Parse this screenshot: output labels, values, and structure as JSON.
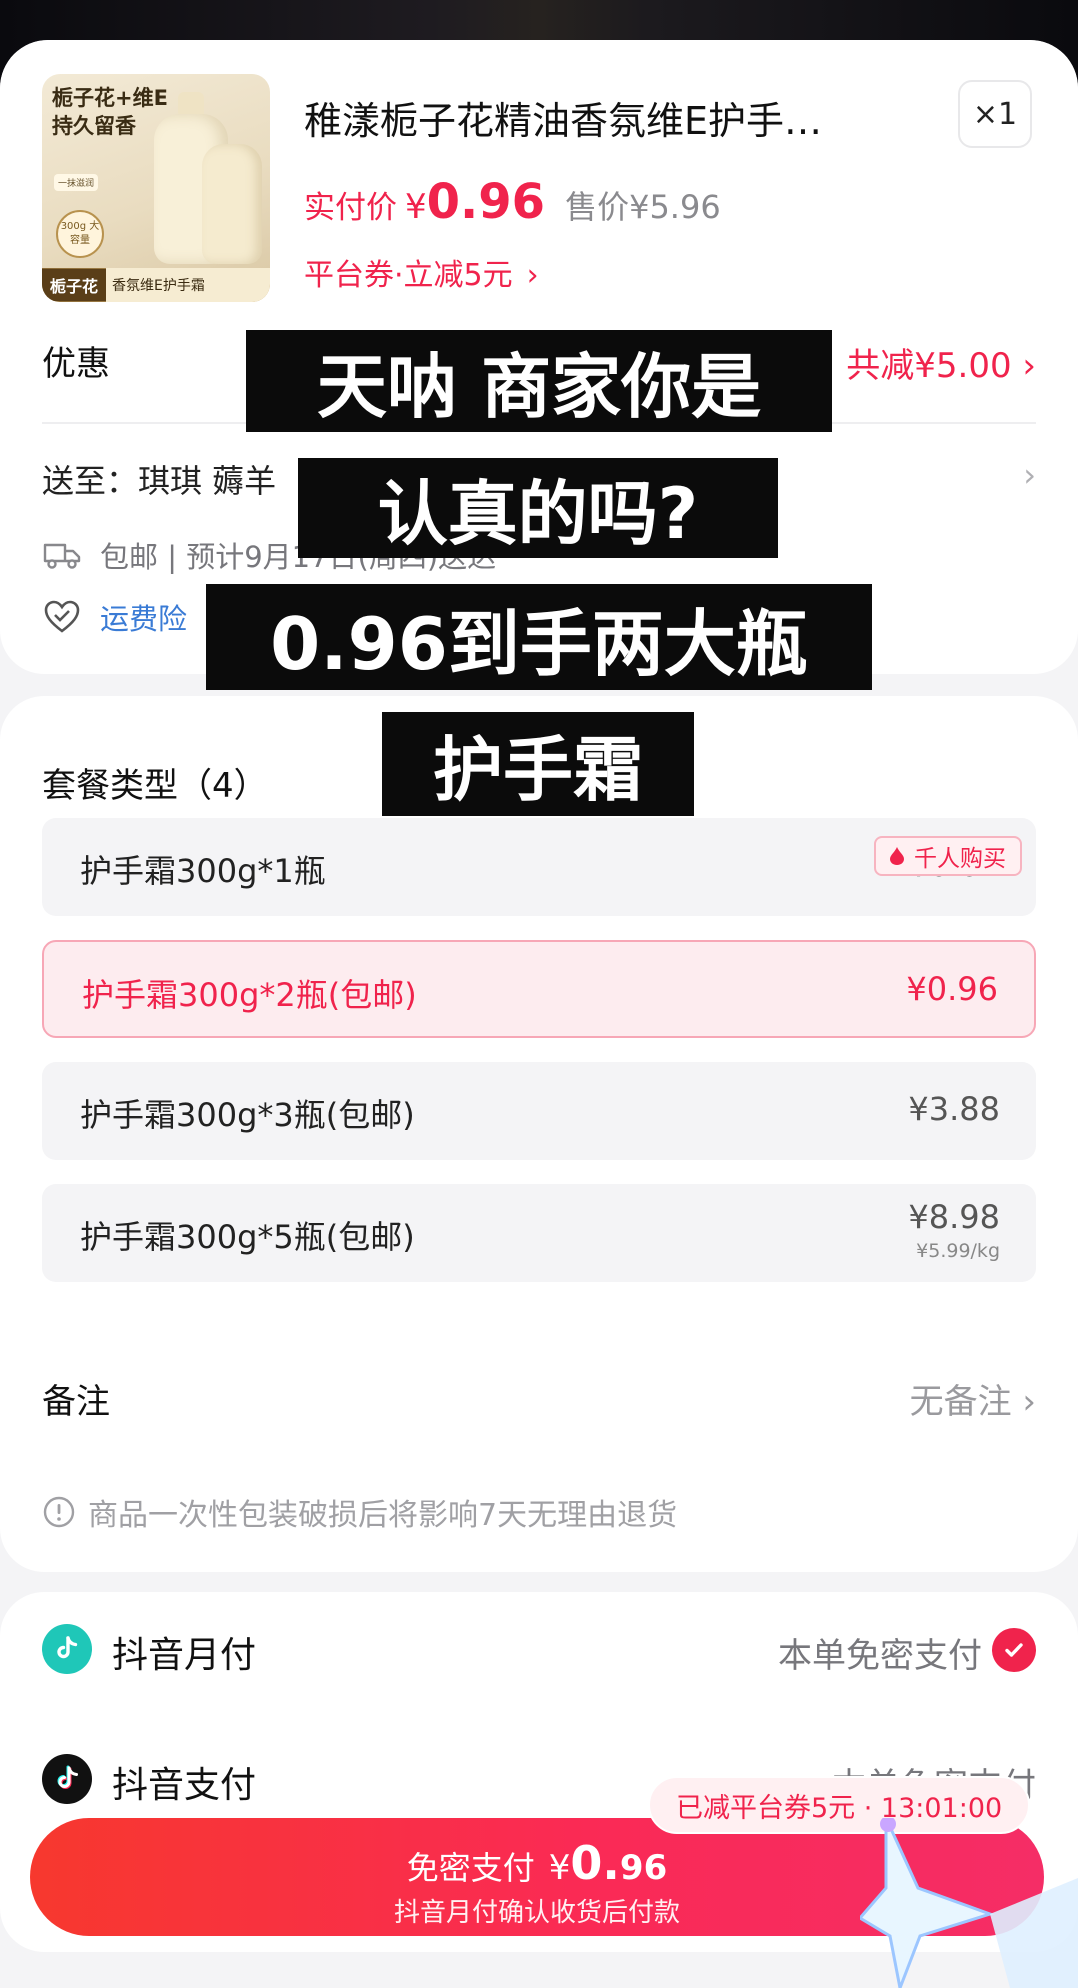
{
  "product": {
    "image_text_1": "栀子花+维E",
    "image_text_2": "持久留香",
    "image_text_3": "一抹滋润",
    "image_badge": "300g 大容量",
    "image_bar_1": "栀子花",
    "image_bar_2": "香氛维E护手霜",
    "title": "稚漾栀子花精油香氛维E护手…",
    "quantity": "×1",
    "actual_price_label": "实付价",
    "currency": "¥",
    "actual_price": "0.96",
    "original_price": "售价¥5.96",
    "coupon": "平台券·立减5元",
    "coupon_chevron": "›"
  },
  "promo": {
    "label": "优惠",
    "value": "共减¥5.00 ›"
  },
  "shipping": {
    "label": "送至：琪琪  薅羊",
    "chevron": "›"
  },
  "delivery": {
    "text": "包邮 | 预计9月17日(周四)送达"
  },
  "insurance": {
    "text": "运费险"
  },
  "package": {
    "title": "套餐类型（4）",
    "tag": "千人购买",
    "options": [
      {
        "name": "护手霜300g*1瓶",
        "price": "¥0.01"
      },
      {
        "name": "护手霜300g*2瓶(包邮)",
        "price": "¥0.96"
      },
      {
        "name": "护手霜300g*3瓶(包邮)",
        "price": "¥3.88"
      },
      {
        "name": "护手霜300g*5瓶(包邮)",
        "price": "¥8.98",
        "unit_price": "¥5.99/kg"
      }
    ],
    "selected_index": 1
  },
  "note": {
    "label": "备注",
    "value": "无备注 ›"
  },
  "warning": "商品一次性包装破损后将影响7天无理由退货",
  "payments": [
    {
      "name": "抖音月付",
      "hint": "本单免密支付",
      "selected": true
    },
    {
      "name": "抖音支付",
      "hint": "本单免密支付",
      "selected": false
    }
  ],
  "pay_button": {
    "label": "免密支付",
    "currency": "¥",
    "amount_int": "0.",
    "amount_dec": "96",
    "sub": "抖音月付确认收货后付款"
  },
  "coupon_pill": "已减平台券5元 · 13:01:00",
  "captions": [
    "天呐 商家你是",
    "认真的吗?",
    "0.96到手两大瓶",
    "护手霜"
  ],
  "colors": {
    "accent": "#f0234c",
    "link": "#3a7bd5",
    "caption_bg": "#0b0b0b"
  }
}
